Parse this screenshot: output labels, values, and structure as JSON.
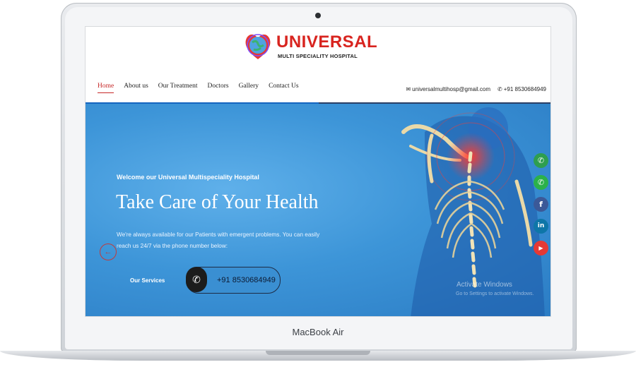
{
  "device": {
    "label": "MacBook Air"
  },
  "site": {
    "logo_title": "UNIVERSAL",
    "logo_subtitle": "MULTI SPECIALITY HOSPITAL",
    "nav": [
      {
        "label": "Home",
        "active": true
      },
      {
        "label": "About us"
      },
      {
        "label": "Our Treatment"
      },
      {
        "label": "Doctors"
      },
      {
        "label": "Gallery"
      },
      {
        "label": "Contact Us"
      }
    ],
    "email": "universalmultihosp@gmail.com",
    "phone_header": "+91 8530684949"
  },
  "hero": {
    "welcome": "Welcome our Universal Multispeciality Hospital",
    "headline": "Take Care of Your Health",
    "description": "We're always available for our Patients with emergent problems. You can easily reach us 24/7 via the phone number below:",
    "services_label": "Our Services",
    "phone_cta": "+91 8530684949",
    "watermark_title": "Activate Windows",
    "watermark_sub": "Go to Settings to activate Windows."
  },
  "social": [
    {
      "icon": "phone-icon",
      "color": "#2e9e4f",
      "glyph": "✆"
    },
    {
      "icon": "whatsapp-icon",
      "color": "#2bb14a",
      "glyph": "✆"
    },
    {
      "icon": "facebook-icon",
      "color": "#3b5998",
      "glyph": "f"
    },
    {
      "icon": "linkedin-icon",
      "color": "#0e76a8",
      "glyph": "in"
    },
    {
      "icon": "youtube-icon",
      "color": "#e53935",
      "glyph": "▶"
    }
  ],
  "colors": {
    "accent": "#d8241f",
    "hero_blue": "#3d95d8",
    "nav_active": "#c62828"
  }
}
